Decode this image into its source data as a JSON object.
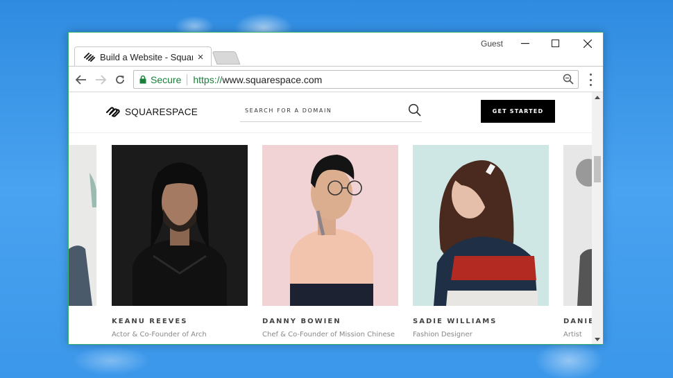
{
  "browser": {
    "tab_title": "Build a Website - Squarespace",
    "tab_close": "×",
    "profile": "Guest",
    "secure_label": "Secure",
    "url_scheme": "https://",
    "url_host": "www.squarespace.com",
    "accent_green": "#188038"
  },
  "site": {
    "logo_text": "SQUARESPACE",
    "search_placeholder": "SEARCH FOR A DOMAIN",
    "cta_label": "GET STARTED"
  },
  "people": [
    {
      "name": "KEANU REEVES",
      "role": "Actor & Co-Founder of Arch"
    },
    {
      "name": "DANNY BOWIEN",
      "role": "Chef & Co-Founder of Mission Chinese"
    },
    {
      "name": "SADIE WILLIAMS",
      "role": "Fashion Designer"
    },
    {
      "name": "DANIE",
      "role": "Artist"
    }
  ],
  "colors": {
    "window_border": "#3ab36b",
    "cta_bg": "#000000",
    "card2_bg": "#f1d3d6",
    "card3_bg": "#cfe7e4"
  }
}
